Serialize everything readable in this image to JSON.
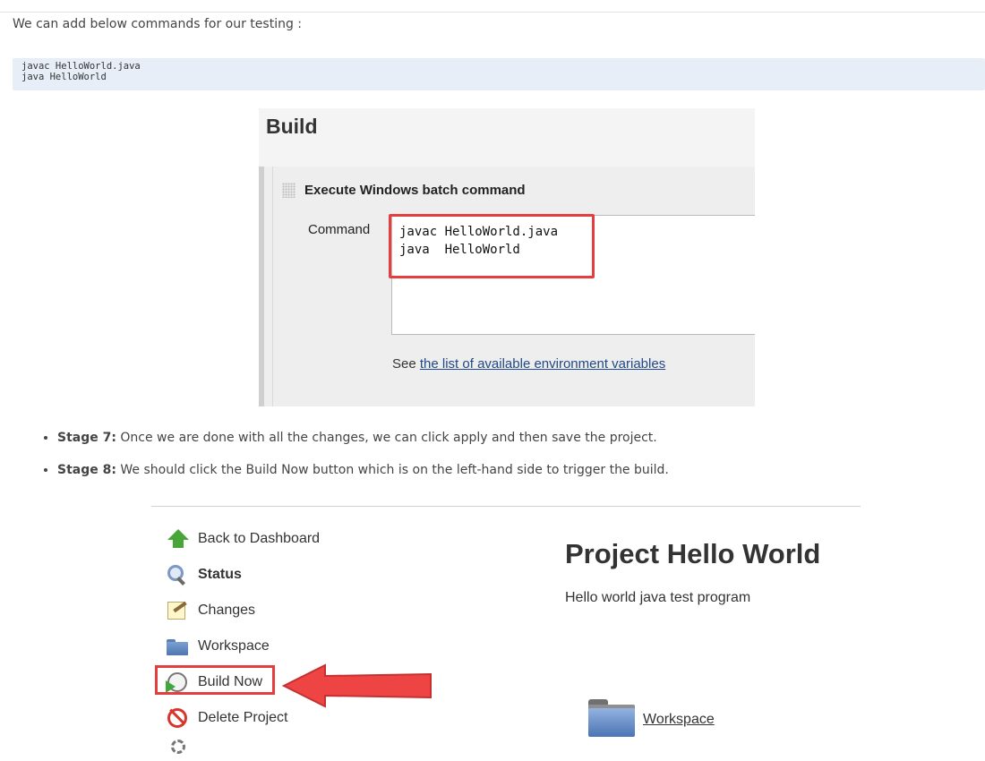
{
  "intro_text": "We can add below commands for our testing :",
  "code_lines": "javac HelloWorld.java\njava HelloWorld",
  "build_panel": {
    "title": "Build",
    "step_title": "Execute Windows batch command",
    "command_label": "Command",
    "command_text": "javac HelloWorld.java\njava  HelloWorld",
    "env_prefix": "See",
    "env_link": "the list of available environment variables"
  },
  "stages": [
    {
      "label": "Stage 7:",
      "text": " Once we are done with all the changes, we can click apply and then save the project."
    },
    {
      "label": "Stage 8:",
      "text": " We should click the Build Now button which is on the left-hand side to trigger the build."
    }
  ],
  "jenkins": {
    "nav": [
      {
        "label": "Back to Dashboard",
        "icon": "arrow-up-icon"
      },
      {
        "label": "Status",
        "icon": "magnifier-icon"
      },
      {
        "label": "Changes",
        "icon": "notepad-icon"
      },
      {
        "label": "Workspace",
        "icon": "folder-icon"
      },
      {
        "label": "Build Now",
        "icon": "clock-icon"
      },
      {
        "label": "Delete Project",
        "icon": "delete-icon"
      }
    ],
    "project_title": "Project Hello World",
    "project_desc": "Hello world java test program",
    "workspace_link": "Workspace"
  },
  "colors": {
    "highlight": "#e53e3e",
    "code_bg": "#e8eef8",
    "link": "#204a87"
  }
}
